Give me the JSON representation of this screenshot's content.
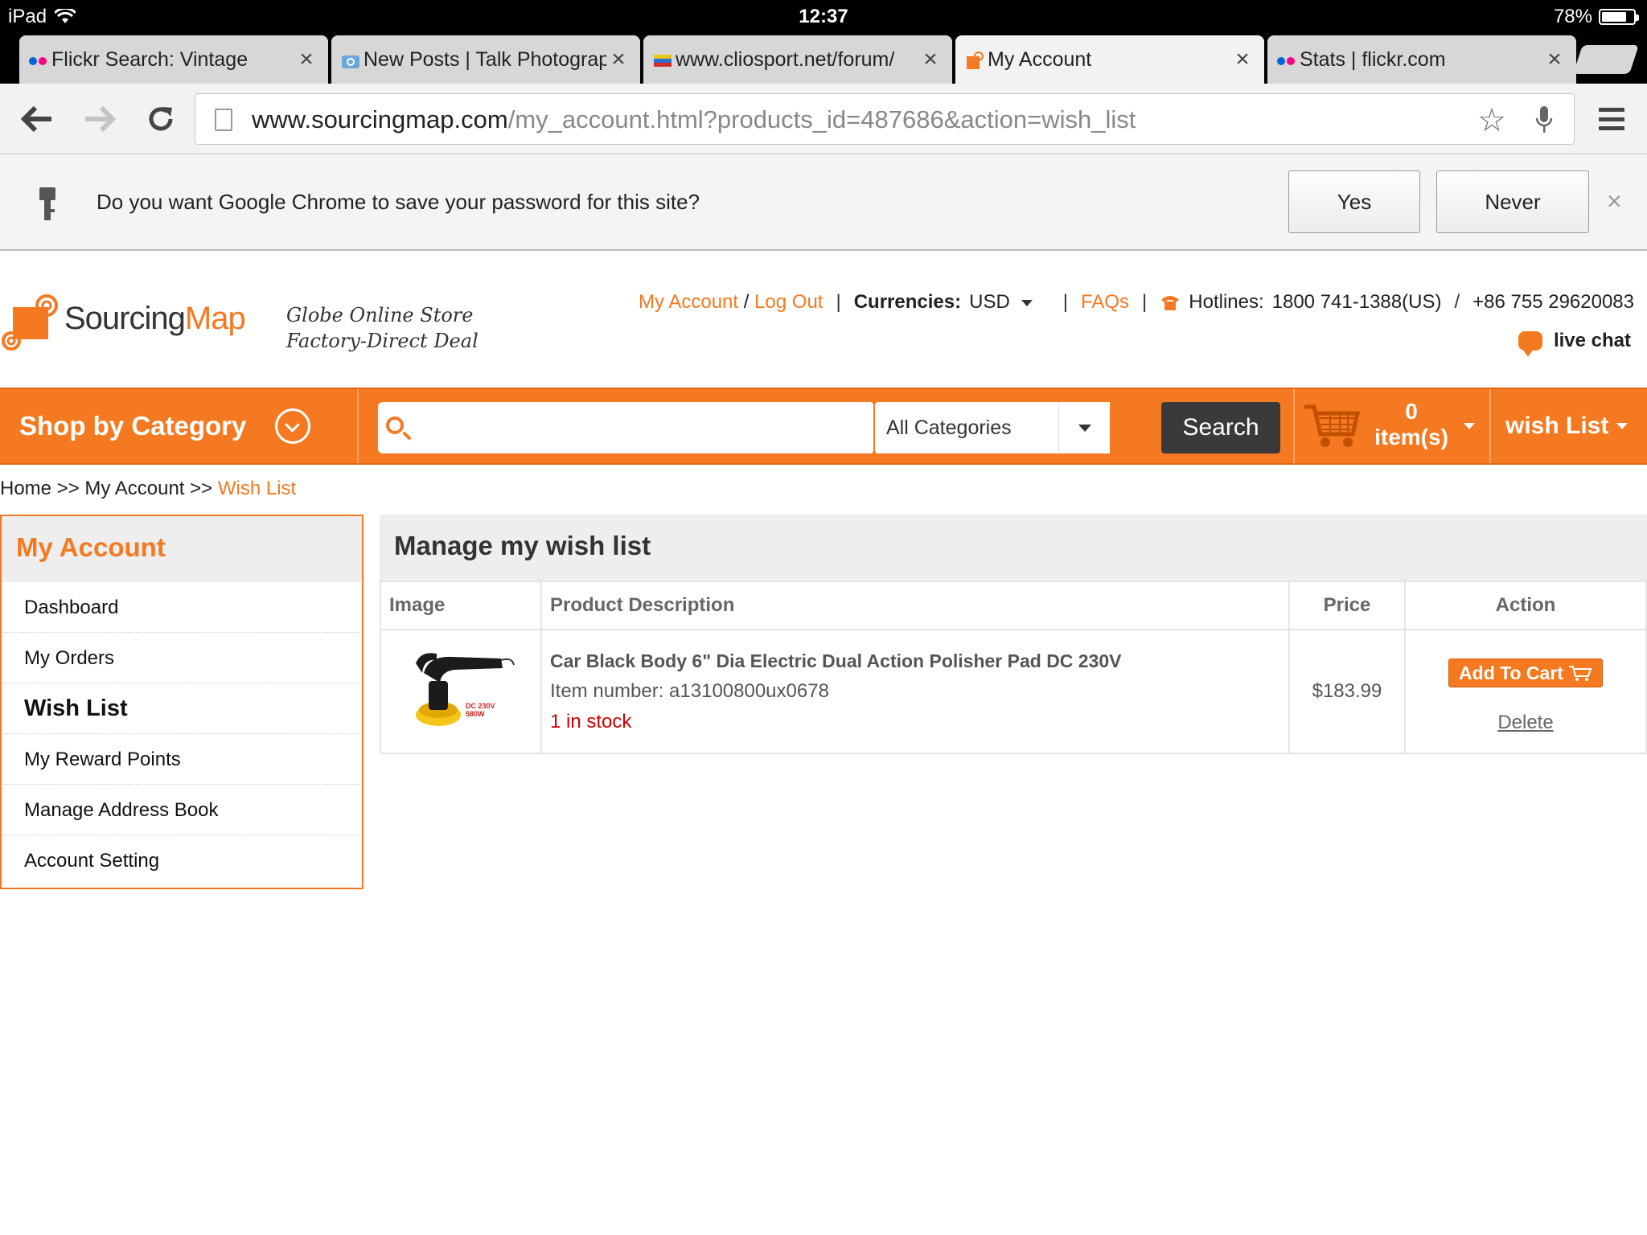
{
  "status": {
    "device": "iPad",
    "time": "12:37",
    "battery": "78%",
    "battery_fraction": 0.78
  },
  "tabs": [
    {
      "title": "Flickr Search: Vintage",
      "favicon": "flickr-icon",
      "active": false
    },
    {
      "title": "New Posts | Talk Photography",
      "favicon": "camera-icon",
      "active": false
    },
    {
      "title": "www.cliosport.net/forum/",
      "favicon": "striped-flag-icon",
      "active": false
    },
    {
      "title": "My Account",
      "favicon": "sourcingmap-icon",
      "active": true
    },
    {
      "title": "Stats | flickr.com",
      "favicon": "flickr-icon",
      "active": false
    }
  ],
  "omnibox": {
    "host": "www.sourcingmap.com",
    "path": "/my_account.html?products_id=487686&action=wish_list"
  },
  "infobar": {
    "message": "Do you want Google Chrome to save your password for this site?",
    "yes_label": "Yes",
    "never_label": "Never",
    "close_glyph": "×"
  },
  "header": {
    "brand_part1": "Sourcing",
    "brand_part2": "Map",
    "slogan_line1": "Globe Online Store",
    "slogan_line2": "Factory-Direct Deal",
    "my_account": "My Account",
    "slash": "/",
    "log_out": "Log Out",
    "sep": "|",
    "currencies_label": "Currencies:",
    "currency": "USD",
    "faqs": "FAQs",
    "hotlines_label": "Hotlines:",
    "hotline_us": "1800 741-1388(US)",
    "hotline_cn": "+86 755 29620083",
    "live_chat": "live chat"
  },
  "nav": {
    "shop_by_category": "Shop by Category",
    "search_placeholder": "",
    "category_select": "All Categories",
    "search_button": "Search",
    "cart_count": "0",
    "cart_items_label": "item(s)",
    "wish_list": "wish List"
  },
  "breadcrumb": {
    "home": "Home",
    "sep": ">>",
    "my_account": "My Account",
    "current": "Wish List"
  },
  "sidebar": {
    "title": "My Account",
    "items": [
      {
        "label": "Dashboard",
        "active": false
      },
      {
        "label": "My Orders",
        "active": false
      },
      {
        "label": "Wish List",
        "active": true
      },
      {
        "label": "My Reward Points",
        "active": false
      },
      {
        "label": "Manage Address Book",
        "active": false
      },
      {
        "label": "Account Setting",
        "active": false
      }
    ]
  },
  "main": {
    "title": "Manage my wish list",
    "columns": [
      "Image",
      "Product Description",
      "Price",
      "Action"
    ],
    "rows": [
      {
        "product_name": "Car Black Body 6\" Dia Electric Dual Action Polisher Pad DC 230V",
        "item_number": "Item number: a13100800ux0678",
        "stock": "1 in stock",
        "price": "$183.99",
        "image_label_1": "DC 230V",
        "image_label_2": "580W",
        "add_to_cart": "Add To Cart",
        "delete": "Delete"
      }
    ]
  },
  "colors": {
    "brand_orange": "#f47920",
    "dark_button": "#3a3a3a",
    "stock_red": "#cc0000"
  }
}
